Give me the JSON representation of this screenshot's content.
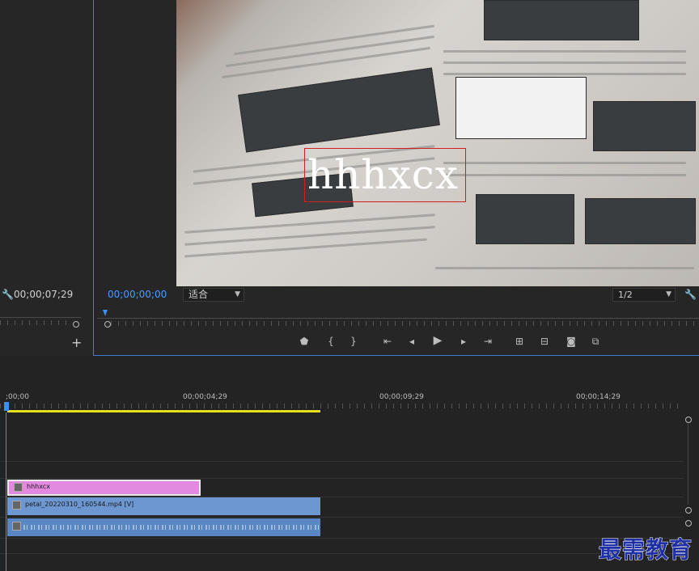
{
  "source_monitor": {
    "timecode": "00;00;07;29"
  },
  "program_monitor": {
    "timecode": "00;00;00;00",
    "zoom": "适合",
    "resolution": "1/2",
    "title_text": "hhhxcx"
  },
  "transport_icons": [
    "marker-icon",
    "mark-in-icon",
    "mark-out-icon",
    "go-to-in-icon",
    "step-back-icon",
    "play-icon",
    "step-forward-icon",
    "go-to-out-icon",
    "lift-icon",
    "extract-icon",
    "export-frame-icon",
    "compare-view-icon"
  ],
  "timeline": {
    "ruler_timecodes": [
      ";00;00",
      "00;00;04;29",
      "00;00;09;29",
      "00;00;14;29"
    ],
    "clips": {
      "title_clip": "hhhxcx",
      "video_clip": "petal_20220310_160544.mp4 [V]"
    }
  },
  "watermark": "最需教育",
  "colors": {
    "accent_blue": "#3a8ef5",
    "title_clip": "#e18ae0",
    "video_clip": "#6d97d0",
    "work_area": "#e6e01e"
  }
}
